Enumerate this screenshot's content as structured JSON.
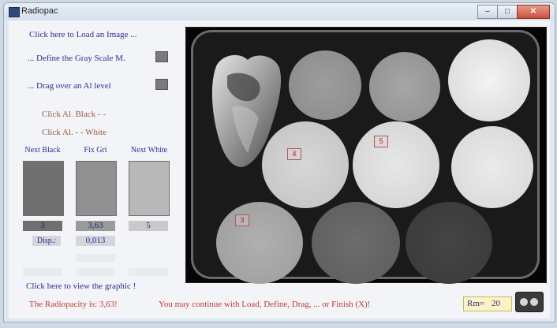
{
  "window": {
    "title": "Radiopac",
    "controls": [
      "–",
      "□",
      "✕"
    ]
  },
  "actions": {
    "load": "Click here to Load an Image ...",
    "define": "... Define the Gray Scale M.",
    "drag": "... Drag over an Al level",
    "al_black": "Click Al. Black  - -",
    "al_white": "Click Al.  - - White"
  },
  "columns": {
    "black": {
      "header": "Next Black",
      "value": "3",
      "color": "#707070"
    },
    "fix": {
      "header": "Fix Gri",
      "value": "3,63",
      "color": "#909090"
    },
    "white": {
      "header": "Next White",
      "value": "5",
      "color": "#b8b8b8"
    }
  },
  "disp": {
    "label": "Disp.:",
    "value": "0,013"
  },
  "view_graphic": "Click here to view the graphic !",
  "status": {
    "result": "The Radiopacity is: 3,63!",
    "hint": "You may continue with Load, Define, Drag, ... or Finish (X)!"
  },
  "rm": {
    "label": "Rm=",
    "value": "20"
  },
  "markers": [
    {
      "label": "4"
    },
    {
      "label": "5"
    },
    {
      "label": "3"
    }
  ]
}
